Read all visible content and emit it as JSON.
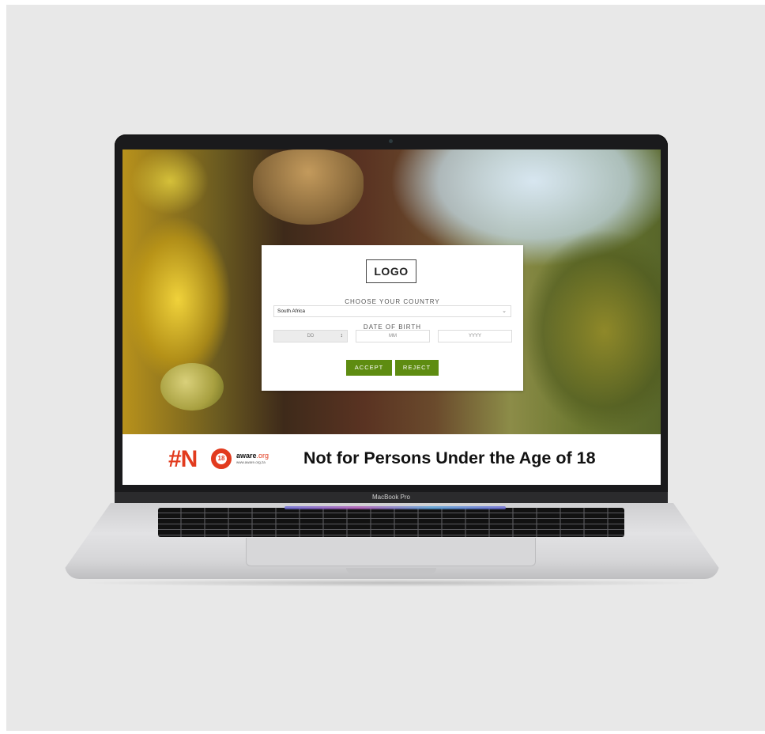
{
  "device": {
    "model_label": "MacBook Pro"
  },
  "age_gate": {
    "logo_text": "LOGO",
    "country_label": "CHOOSE YOUR COUNTRY",
    "country_value": "South Africa",
    "dob_label": "DATE OF BIRTH",
    "day_placeholder": "DD",
    "month_placeholder": "MM",
    "year_placeholder": "YYYY",
    "accept_label": "ACCEPT",
    "reject_label": "REJECT",
    "button_color": "#5e8c11"
  },
  "banner": {
    "hashtag": "#N",
    "badge_number": "18",
    "aware_brand": "aware",
    "aware_suffix": ".org",
    "aware_url": "www.aware.org.za",
    "message": "Not for Persons Under the Age of 18",
    "accent_color": "#e23b1e"
  },
  "icons": {
    "select_chevron": "chevron-down-icon",
    "day_spinner": "spinner-icon"
  }
}
